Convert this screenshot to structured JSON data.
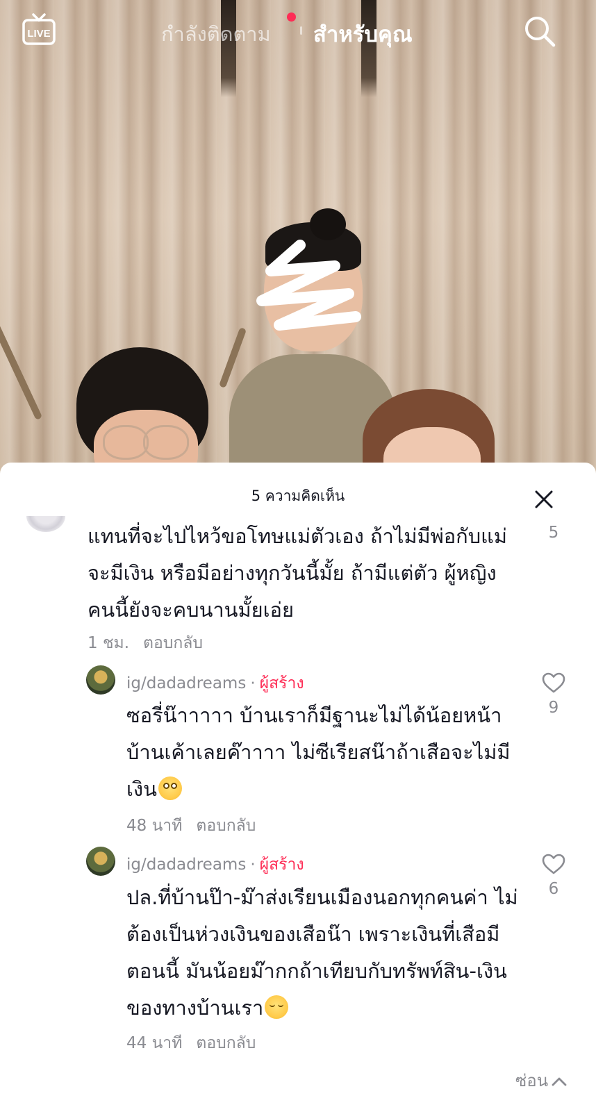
{
  "topnav": {
    "live_icon": "live-tv-icon",
    "tab_following": "กำลังติดตาม",
    "tab_for_you": "สำหรับคุณ",
    "search_icon": "search-icon"
  },
  "comments_sheet": {
    "title": "5 ความคิดเห็น",
    "close_icon": "close-icon",
    "comments": [
      {
        "text": "แทนที่จะไปไหว้ขอโทษแม่ตัวเอง ถ้าไม่มีพ่อกับแม่ จะมีเงิน หรือมีอย่างทุกวันนี้มั้ย ถ้ามีแต่ตัว ผู้หญิงคนนี้ยังจะคบนานมั้ยเอ่ย",
        "time": "1 ชม.",
        "reply_label": "ตอบกลับ",
        "likes": "5"
      }
    ],
    "replies": [
      {
        "username": "ig/dadadreams",
        "separator": "·",
        "creator_badge": "ผู้สร้าง",
        "text": "ซอรี่น๊าาาาา บ้านเราก็มีฐานะไม่ได้น้อยหน้าบ้านเค้าเลยค๊าาาา ไม่ซีเรียสน๊าถ้าเสือจะไม่มีเงิน",
        "emoji": "flushed-face",
        "time": "48 นาที",
        "reply_label": "ตอบกลับ",
        "likes": "9"
      },
      {
        "username": "ig/dadadreams",
        "separator": "·",
        "creator_badge": "ผู้สร้าง",
        "text": "ปล.ที่บ้านป๊า-ม๊าส่งเรียนเมืองนอกทุกคนค่า ไม่ต้องเป็นห่วงเงินของเสือน๊า เพราะเงินที่เสือมีตอนนี้ มันน้อยม๊ากกถ้าเทียบกับทรัพท์สิน-เงินของทางบ้านเรา",
        "emoji": "relieved-face",
        "time": "44 นาที",
        "reply_label": "ตอบกลับ",
        "likes": "6"
      }
    ],
    "hide_label": "ซ่อน"
  }
}
